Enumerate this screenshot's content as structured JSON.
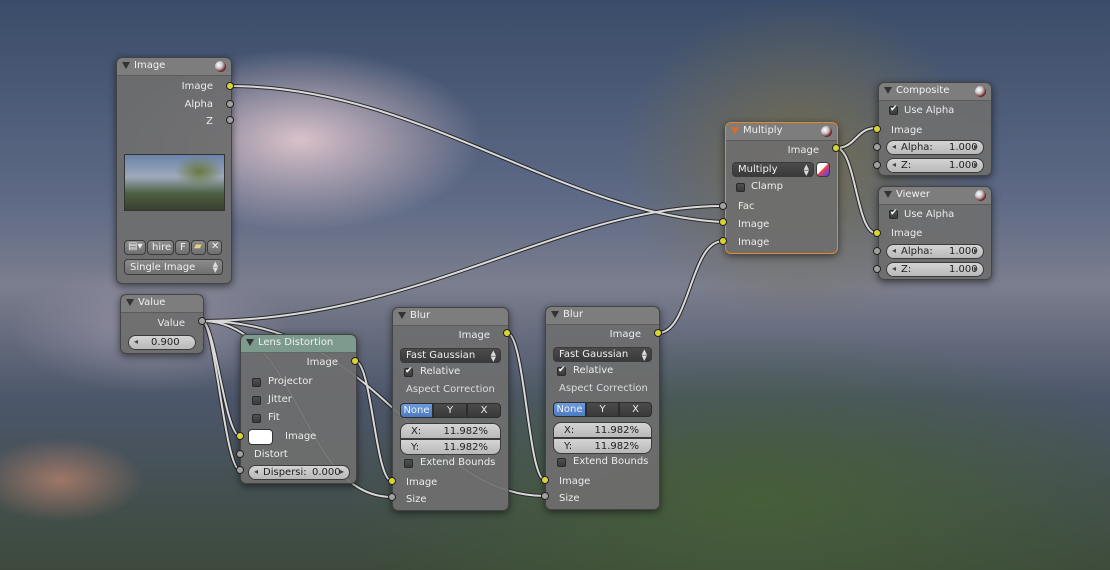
{
  "background": {
    "description_colors": [
      "#3a4c69",
      "#f0d2d7",
      "#465f37"
    ]
  },
  "colors": {
    "socket_yellow": "#d8d435",
    "socket_grey": "#a0a0a0",
    "active_border": "#e08a2c",
    "selected_blue": "#5a8ad2"
  },
  "image_node": {
    "title": "Image",
    "outputs": [
      "Image",
      "Alpha",
      "Z"
    ],
    "file_name": "hire",
    "fake_user": "F",
    "source": "Single Image",
    "icons": [
      "image-browse-icon",
      "open-folder-icon",
      "close-icon"
    ]
  },
  "value_node": {
    "title": "Value",
    "output": "Value",
    "value": "0.900"
  },
  "lens_node": {
    "title": "Lens Distortion",
    "output": "Image",
    "options": [
      "Projector",
      "Jitter",
      "Fit"
    ],
    "input_image": "Image",
    "input_distort": "Distort",
    "dispersion_label": "Dispersi:",
    "dispersion_value": "0.000"
  },
  "blur1": {
    "title": "Blur",
    "output": "Image",
    "filter": "Fast Gaussian",
    "relative": "Relative",
    "aspect": "Aspect Correction",
    "aspect_options": [
      "None",
      "Y",
      "X"
    ],
    "x_label": "X:",
    "x_value": "11.982%",
    "y_label": "Y:",
    "y_value": "11.982%",
    "extend": "Extend Bounds",
    "in_image": "Image",
    "in_size": "Size"
  },
  "blur2": {
    "title": "Blur",
    "output": "Image",
    "filter": "Fast Gaussian",
    "relative": "Relative",
    "aspect": "Aspect Correction",
    "aspect_options": [
      "None",
      "Y",
      "X"
    ],
    "x_label": "X:",
    "x_value": "11.982%",
    "y_label": "Y:",
    "y_value": "11.982%",
    "extend": "Extend Bounds",
    "in_image": "Image",
    "in_size": "Size"
  },
  "multiply": {
    "title": "Multiply",
    "output": "Image",
    "blend": "Multiply",
    "clamp": "Clamp",
    "in_fac": "Fac",
    "in_image1": "Image",
    "in_image2": "Image"
  },
  "composite": {
    "title": "Composite",
    "use_alpha": "Use Alpha",
    "in_image": "Image",
    "alpha_label": "Alpha:",
    "alpha_value": "1.000",
    "z_label": "Z:",
    "z_value": "1.000"
  },
  "viewer": {
    "title": "Viewer",
    "use_alpha": "Use Alpha",
    "in_image": "Image",
    "alpha_label": "Alpha:",
    "alpha_value": "1.000",
    "z_label": "Z:",
    "z_value": "1.000"
  }
}
